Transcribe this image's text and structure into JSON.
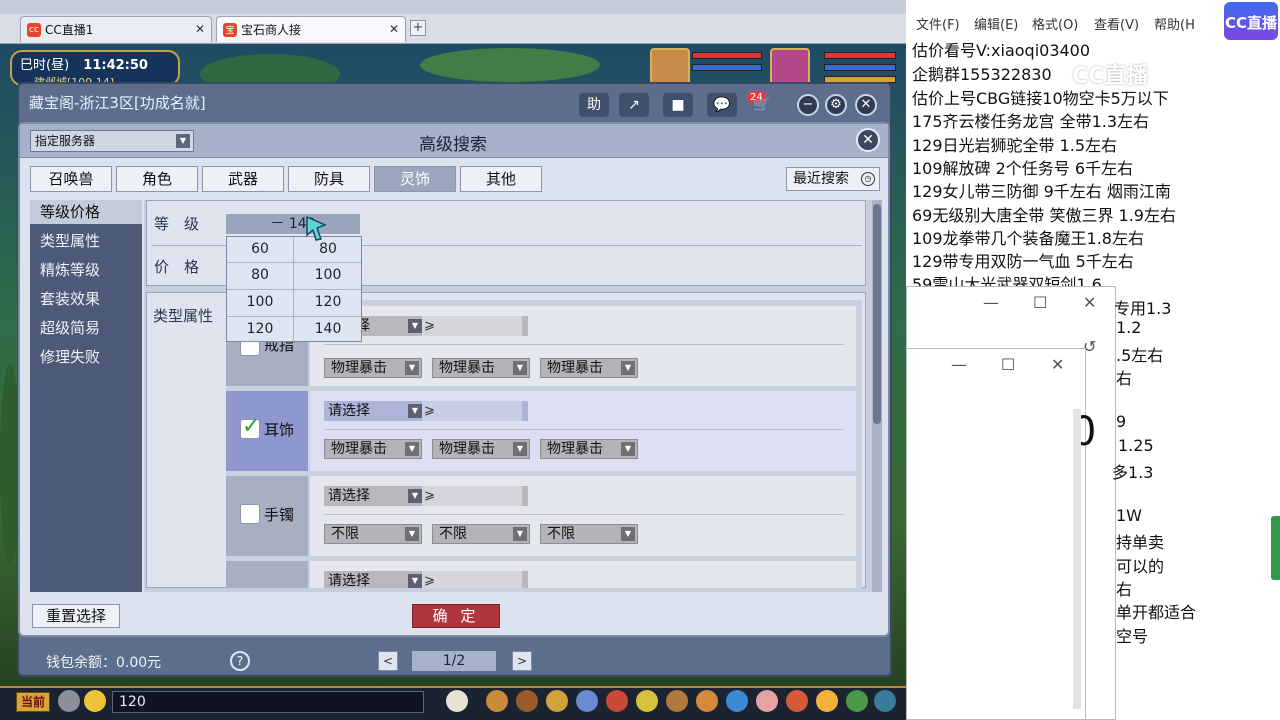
{
  "browser": {
    "tabs": [
      {
        "label": "CC直播1",
        "close": "✕"
      },
      {
        "label": "宝石商人接",
        "close": "✕"
      }
    ],
    "new_tab": "+"
  },
  "game": {
    "clock": {
      "period": "巳时(昼)",
      "time": "11:42:50",
      "location": "建邺城[109,14]"
    }
  },
  "cbg": {
    "title": "藏宝阁-浙江3区[功成名就]",
    "toolbar": {
      "help": "助",
      "share": "↗",
      "stop": "■",
      "chat_badge": "24",
      "cart": "🛒"
    },
    "window_controls": {
      "minimize": "−",
      "settings": "⚙",
      "close": "✕"
    },
    "wallet": "钱包余额：0.00元",
    "help": "?",
    "pager": {
      "prev": "<",
      "page": "1/2",
      "next": ">"
    }
  },
  "advanced_search": {
    "server_label": "指定服务器",
    "title": "高级搜索",
    "close": "✕",
    "categories": [
      "召唤兽",
      "角色",
      "武器",
      "防具",
      "灵饰",
      "其他"
    ],
    "active_category": "灵饰",
    "recent_search": "最近搜索",
    "sidebar": [
      "等级价格",
      "类型属性",
      "精炼等级",
      "套装效果",
      "超级简易",
      "修理失败"
    ],
    "level_label": "等　级",
    "level_value": "－ 140",
    "price_label": "价　格",
    "type_label": "类型属性",
    "level_options": [
      [
        "60",
        "80"
      ],
      [
        "80",
        "100"
      ],
      [
        "100",
        "120"
      ],
      [
        "120",
        "140"
      ]
    ],
    "rows": [
      {
        "name": "戒指",
        "checked": false,
        "select": "请选择",
        "attrs": [
          "物理暴击",
          "物理暴击",
          "物理暴击"
        ]
      },
      {
        "name": "耳饰",
        "checked": true,
        "select": "请选择",
        "attrs": [
          "物理暴击",
          "物理暴击",
          "物理暴击"
        ]
      },
      {
        "name": "手镯",
        "checked": false,
        "select": "请选择",
        "attrs": [
          "不限",
          "不限",
          "不限"
        ]
      },
      {
        "name": "",
        "checked": false,
        "select": "请选择",
        "attrs": []
      }
    ],
    "select_suffix": "⩾",
    "reset": "重置选择",
    "confirm": "确 定"
  },
  "bottom_bar": {
    "now": "当前",
    "chat_value": "120"
  },
  "notepad": {
    "menu": [
      "文件(F)",
      "编辑(E)",
      "格式(O)",
      "查看(V)",
      "帮助(H"
    ],
    "lines": [
      "估价看号V:xiaoqi03400",
      "企鹅群155322830",
      "估价上号CBG链接10物空卡5万以下",
      "175齐云楼任务龙宫  全带1.3左右",
      "129日光岩狮驼全带  1.5左右",
      "109解放碑 2个任务号 6千左右",
      "129女儿带三防御 9千左右 烟雨江南",
      "69无级别大唐全带  笑傲三界 1.9左右",
      "109龙拳带几个装备魔王1.8左右",
      "129带专用双防一气血 5千左右",
      "59雷山大光武器双短剑1.6"
    ],
    "fragments": [
      "专用1.3",
      "1.2",
      ".5左右",
      "右",
      "9",
      "1.25",
      "多1.3",
      "1W",
      "持单卖",
      "可以的",
      "右",
      "单开都适合",
      "空号"
    ],
    "watermark": "CC直播",
    "logo": "CC直播"
  }
}
